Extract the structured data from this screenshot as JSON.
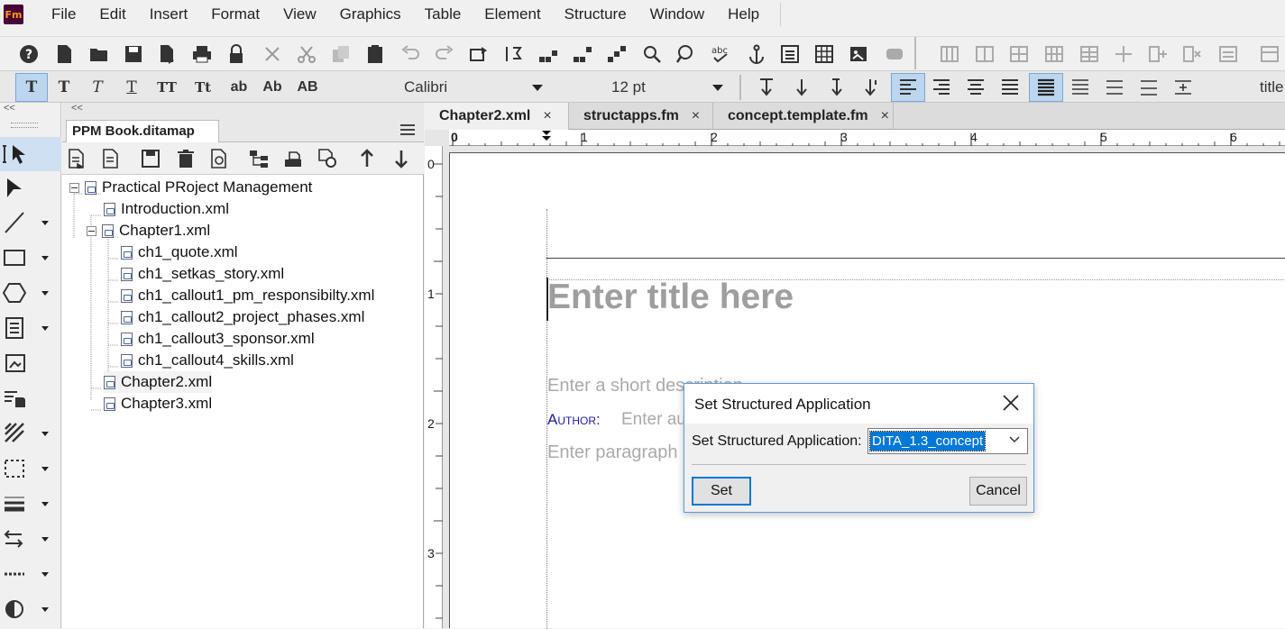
{
  "menu": {
    "items": [
      "File",
      "Edit",
      "Insert",
      "Format",
      "View",
      "Graphics",
      "Table",
      "Element",
      "Structure",
      "Window",
      "Help"
    ]
  },
  "toolbar": {
    "logo_text": "Fm",
    "format_buttons": [
      "T",
      "T",
      "T",
      "T",
      "TT",
      "Tt",
      "ab",
      "Ab",
      "AB"
    ],
    "font": "Calibri",
    "size": "12 pt",
    "style_label": "title"
  },
  "panel": {
    "tab_label": "PPM Book.ditamap",
    "collapse_label": "<<",
    "tree": [
      {
        "label": "Practical PRoject Management"
      },
      {
        "label": "Introduction.xml"
      },
      {
        "label": "Chapter1.xml"
      },
      {
        "label": "ch1_quote.xml"
      },
      {
        "label": "ch1_setkas_story.xml"
      },
      {
        "label": "ch1_callout1_pm_responsibilty.xml"
      },
      {
        "label": "ch1_callout2_project_phases.xml"
      },
      {
        "label": "ch1_callout3_sponsor.xml"
      },
      {
        "label": "ch1_callout4_skills.xml"
      },
      {
        "label": "Chapter2.xml"
      },
      {
        "label": "Chapter3.xml"
      }
    ]
  },
  "tools": {
    "collapse_label": "<<"
  },
  "doc_tabs": [
    {
      "label": "Chapter2.xml",
      "close": "×"
    },
    {
      "label": "structapps.fm",
      "close": "×"
    },
    {
      "label": "concept.template.fm",
      "close": "×"
    }
  ],
  "ruler": {
    "top_numbers": [
      "0",
      "1",
      "2",
      "3",
      "4",
      "5",
      "6"
    ],
    "left_numbers": [
      "0",
      "1",
      "2",
      "3"
    ]
  },
  "document": {
    "title_placeholder": "Enter title here",
    "shortdesc_placeholder": "Enter a short description",
    "author_label": "Author:",
    "author_placeholder": "Enter author",
    "para_placeholder": "Enter paragraph"
  },
  "dialog": {
    "title": "Set Structured Application",
    "field_label": "Set Structured Application:",
    "selected_value": "DITA_1.3_concept",
    "set_label": "Set",
    "cancel_label": "Cancel"
  }
}
